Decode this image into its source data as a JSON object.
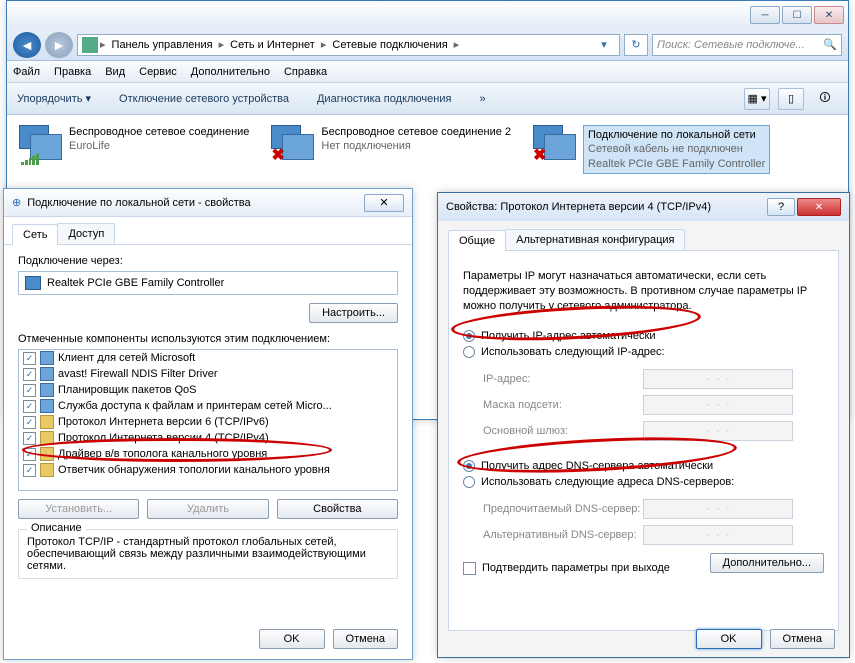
{
  "breadcrumb": [
    "Панель управления",
    "Сеть и Интернет",
    "Сетевые подключения"
  ],
  "search_placeholder": "Поиск: Сетевые подключе...",
  "menubar": [
    "Файл",
    "Правка",
    "Вид",
    "Сервис",
    "Дополнительно",
    "Справка"
  ],
  "cmdbar": {
    "organize": "Упорядочить",
    "disable": "Отключение сетевого устройства",
    "diag": "Диагностика подключения"
  },
  "connections": [
    {
      "name": "Беспроводное сетевое соединение",
      "status": "EuroLife",
      "crossed": false
    },
    {
      "name": "Беспроводное сетевое соединение 2",
      "status": "Нет подключения",
      "crossed": true
    },
    {
      "name": "Подключение по локальной сети",
      "status": "Сетевой кабель не подключен",
      "adapter": "Realtek PCIe GBE Family Controller",
      "crossed": true,
      "selected": true
    }
  ],
  "dlg1": {
    "title": "Подключение по локальной сети - свойства",
    "tabs": [
      "Сеть",
      "Доступ"
    ],
    "connect_using": "Подключение через:",
    "adapter": "Realtek PCIe GBE Family Controller",
    "configure": "Настроить...",
    "components_label": "Отмеченные компоненты используются этим подключением:",
    "components": [
      "Клиент для сетей Microsoft",
      "avast! Firewall NDIS Filter Driver",
      "Планировщик пакетов QoS",
      "Служба доступа к файлам и принтерам сетей Micro...",
      "Протокол Интернета версии 6 (TCP/IPv6)",
      "Протокол Интернета версии 4 (TCP/IPv4)",
      "Драйвер в/в тополога канального уровня",
      "Ответчик обнаружения топологии канального уровня"
    ],
    "install": "Установить...",
    "remove": "Удалить",
    "properties": "Свойства",
    "desc_label": "Описание",
    "desc": "Протокол TCP/IP - стандартный протокол глобальных сетей, обеспечивающий связь между различными взаимодействующими сетями.",
    "ok": "OK",
    "cancel": "Отмена"
  },
  "dlg2": {
    "title": "Свойства: Протокол Интернета версии 4 (TCP/IPv4)",
    "tabs": [
      "Общие",
      "Альтернативная конфигурация"
    ],
    "desc": "Параметры IP могут назначаться автоматически, если сеть поддерживает эту возможность. В противном случае параметры IP можно получить у сетевого администратора.",
    "r1": "Получить IP-адрес автоматически",
    "r2": "Использовать следующий IP-адрес:",
    "ip_label": "IP-адрес:",
    "mask_label": "Маска подсети:",
    "gw_label": "Основной шлюз:",
    "r3": "Получить адрес DNS-сервера автоматически",
    "r4": "Использовать следующие адреса DNS-серверов:",
    "dns1": "Предпочитаемый DNS-сервер:",
    "dns2": "Альтернативный DNS-сервер:",
    "validate": "Подтвердить параметры при выходе",
    "advanced": "Дополнительно...",
    "ok": "OK",
    "cancel": "Отмена"
  }
}
